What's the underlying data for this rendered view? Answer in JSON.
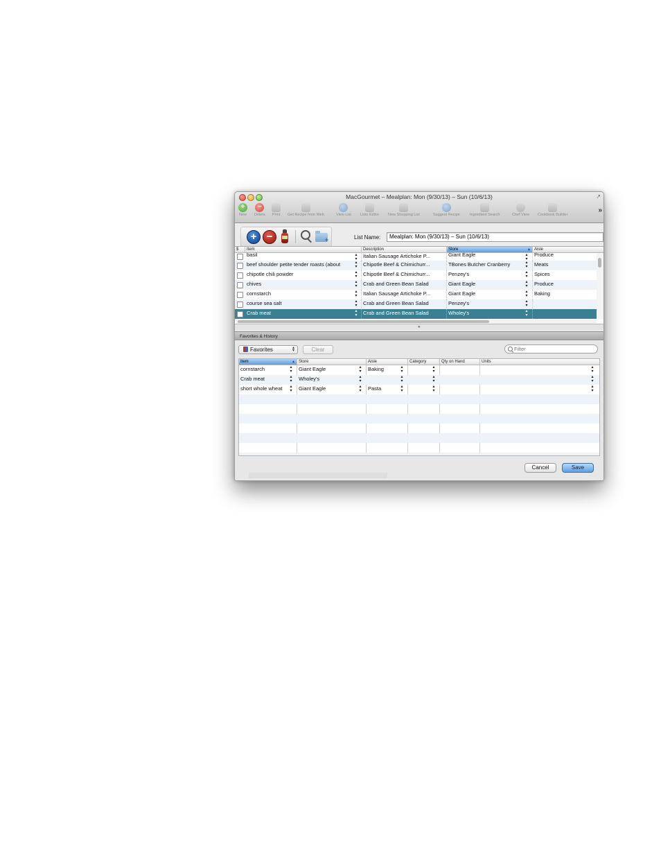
{
  "window": {
    "title": "MacGourmet – Mealplan: Mon (9/30/13) – Sun (10/6/13)"
  },
  "toolbar": {
    "items": [
      {
        "label": "New",
        "icon": "plus-circle-icon"
      },
      {
        "label": "Delete",
        "icon": "minus-circle-icon"
      },
      {
        "label": "Print",
        "icon": "printer-icon"
      },
      {
        "label": "Get Recipe from Web",
        "icon": "web-recipe-icon"
      },
      {
        "label": "View List",
        "icon": "view-list-icon"
      },
      {
        "label": "Lists Editor",
        "icon": "lists-editor-icon"
      },
      {
        "label": "New Shopping List",
        "icon": "shopping-list-icon"
      },
      {
        "label": "Suggest Recipe",
        "icon": "suggest-recipe-icon"
      },
      {
        "label": "Ingredient Search",
        "icon": "ingredient-search-icon"
      },
      {
        "label": "Chef View",
        "icon": "chef-view-icon"
      },
      {
        "label": "Cookbook Builder",
        "icon": "cookbook-builder-icon"
      }
    ],
    "overflow": "»"
  },
  "list_name": {
    "label": "List Name:",
    "value": "Mealplan: Mon (9/30/13) – Sun (10/6/13)"
  },
  "shopping_table": {
    "columns": [
      "$",
      "Item",
      "Description",
      "Store",
      "Aisle"
    ],
    "rows": [
      {
        "item": "basil",
        "description": "Italian Sausage Artichoke P...",
        "store": "Giant Eagle",
        "aisle": "Produce"
      },
      {
        "item": "beef shoulder petite tender roasts (about",
        "description": "Chipotle Beef & Chimichurr...",
        "store": "TBones Butcher Cranberry",
        "aisle": "Meats"
      },
      {
        "item": "chipotle chili powder",
        "description": "Chipotle Beef & Chimichurr...",
        "store": "Penzey's",
        "aisle": "Spices"
      },
      {
        "item": "chives",
        "description": "Crab and Green Bean Salad",
        "store": "Giant Eagle",
        "aisle": "Produce"
      },
      {
        "item": "cornstarch",
        "description": "Italian Sausage Artichoke P...",
        "store": "Giant Eagle",
        "aisle": "Baking"
      },
      {
        "item": "course sea salt",
        "description": "Crab and Green Bean Salad",
        "store": "Penzey's",
        "aisle": ""
      },
      {
        "item": "Crab meat",
        "description": "Crab and Green Bean Salad",
        "store": "Wholey's",
        "aisle": ""
      }
    ]
  },
  "favorites": {
    "header": "Favorites & History",
    "select_value": "Favorites",
    "clear_label": "Clear",
    "filter_placeholder": "Filter",
    "columns": [
      "Item",
      "Store",
      "Aisle",
      "Category",
      "Qty on Hand",
      "Units"
    ],
    "rows": [
      {
        "item": "cornstarch",
        "store": "Giant Eagle",
        "aisle": "Baking",
        "category": "",
        "qty": "",
        "units": ""
      },
      {
        "item": "Crab meat",
        "store": "Wholey's",
        "aisle": "",
        "category": "",
        "qty": "",
        "units": ""
      },
      {
        "item": "short whole wheat",
        "store": "Giant Eagle",
        "aisle": "Pasta",
        "category": "",
        "qty": "",
        "units": ""
      }
    ]
  },
  "buttons": {
    "cancel": "Cancel",
    "save": "Save"
  },
  "colors": {
    "selected_row": "#3b7f93",
    "alt_row": "#eef3fa",
    "sorted_header": "#5e9ee0"
  }
}
